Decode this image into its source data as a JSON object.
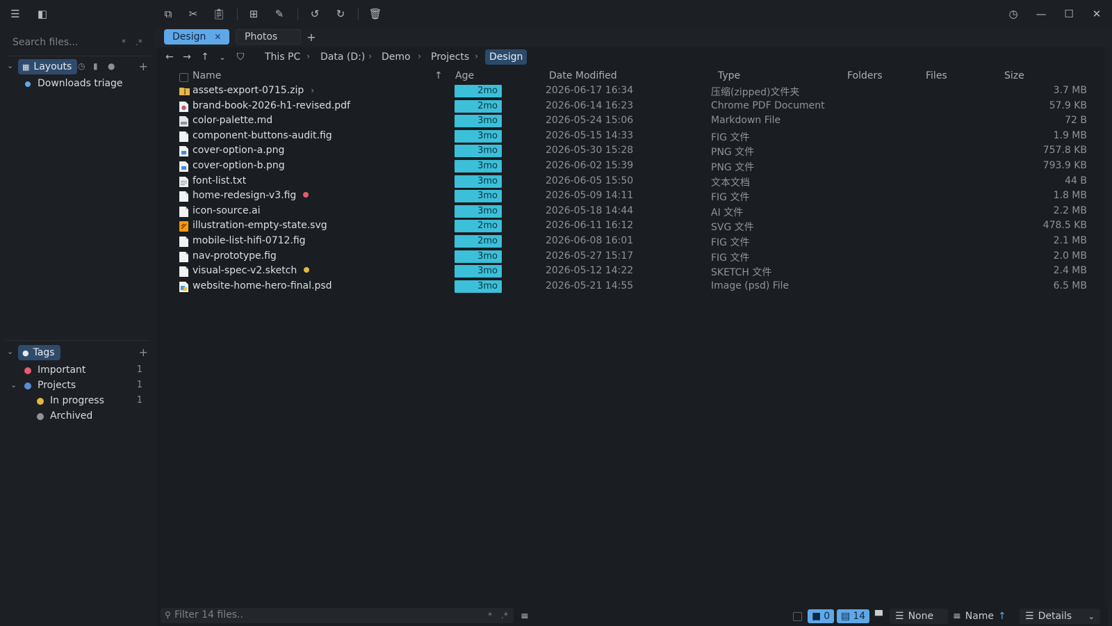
{
  "search": {
    "placeholder": "Search files..."
  },
  "sidebar": {
    "layouts_label": "Layouts",
    "layouts": [
      {
        "label": "Downloads triage"
      }
    ],
    "tags_label": "Tags",
    "tags": [
      {
        "label": "Important",
        "count": "1",
        "color": "#e35d6a"
      },
      {
        "label": "Projects",
        "count": "1",
        "color": "#5b8fd4"
      },
      {
        "label": "In progress",
        "count": "1",
        "color": "#e2b93b"
      },
      {
        "label": "Archived",
        "count": "",
        "color": "#8e949a"
      }
    ]
  },
  "tabs": [
    {
      "label": "Design",
      "active": true
    },
    {
      "label": "Photos",
      "active": false
    }
  ],
  "breadcrumb": [
    "This PC",
    "Data (D:)",
    "Demo",
    "Projects",
    "Design"
  ],
  "columns": {
    "name": "Name",
    "age": "Age",
    "date": "Date Modified",
    "type": "Type",
    "folders": "Folders",
    "files": "Files",
    "size": "Size"
  },
  "files": [
    {
      "name": "assets-export-0715.zip",
      "age": "2mo",
      "date": "2026-06-17 16:34",
      "type": "压缩(zipped)文件夹",
      "size": "3.7 MB",
      "icon": "zip-folder-icon"
    },
    {
      "name": "brand-book-2026-h1-revised.pdf",
      "age": "2mo",
      "date": "2026-06-14 16:23",
      "type": "Chrome PDF Document",
      "size": "57.9 KB",
      "icon": "pdf-icon"
    },
    {
      "name": "color-palette.md",
      "age": "3mo",
      "date": "2026-05-24 15:06",
      "type": "Markdown File",
      "size": "72 B",
      "icon": "markdown-icon"
    },
    {
      "name": "component-buttons-audit.fig",
      "age": "3mo",
      "date": "2026-05-15 14:33",
      "type": "FIG 文件",
      "size": "1.9 MB",
      "icon": "file-icon"
    },
    {
      "name": "cover-option-a.png",
      "age": "3mo",
      "date": "2026-05-30 15:28",
      "type": "PNG 文件",
      "size": "757.8 KB",
      "icon": "image-icon"
    },
    {
      "name": "cover-option-b.png",
      "age": "3mo",
      "date": "2026-06-02 15:39",
      "type": "PNG 文件",
      "size": "793.9 KB",
      "icon": "image-icon"
    },
    {
      "name": "font-list.txt",
      "age": "3mo",
      "date": "2026-06-05 15:50",
      "type": "文本文档",
      "size": "44 B",
      "icon": "text-file-icon"
    },
    {
      "name": "home-redesign-v3.fig",
      "age": "3mo",
      "date": "2026-05-09 14:11",
      "type": "FIG 文件",
      "size": "1.8 MB",
      "icon": "file-icon",
      "tag": "#e35d6a"
    },
    {
      "name": "icon-source.ai",
      "age": "3mo",
      "date": "2026-05-18 14:44",
      "type": "AI 文件",
      "size": "2.2 MB",
      "icon": "file-icon"
    },
    {
      "name": "illustration-empty-state.svg",
      "age": "2mo",
      "date": "2026-06-11 16:12",
      "type": "SVG 文件",
      "size": "478.5 KB",
      "icon": "svg-icon"
    },
    {
      "name": "mobile-list-hifi-0712.fig",
      "age": "2mo",
      "date": "2026-06-08 16:01",
      "type": "FIG 文件",
      "size": "2.1 MB",
      "icon": "file-icon"
    },
    {
      "name": "nav-prototype.fig",
      "age": "3mo",
      "date": "2026-05-27 15:17",
      "type": "FIG 文件",
      "size": "2.0 MB",
      "icon": "file-icon"
    },
    {
      "name": "visual-spec-v2.sketch",
      "age": "3mo",
      "date": "2026-05-12 14:22",
      "type": "SKETCH 文件",
      "size": "2.4 MB",
      "icon": "file-icon",
      "tag": "#e2b93b"
    },
    {
      "name": "website-home-hero-final.psd",
      "age": "3mo",
      "date": "2026-05-21 14:55",
      "type": "Image (psd) File",
      "size": "6.5 MB",
      "icon": "psd-icon"
    }
  ],
  "status": {
    "filter_placeholder": "Filter 14 files..",
    "folder_count": "0",
    "file_count": "14",
    "group_by": "None",
    "sort_by": "Name",
    "view": "Details"
  },
  "colors": {
    "accent": "#5fa8e8",
    "age_badge": "#3cbfd9"
  }
}
